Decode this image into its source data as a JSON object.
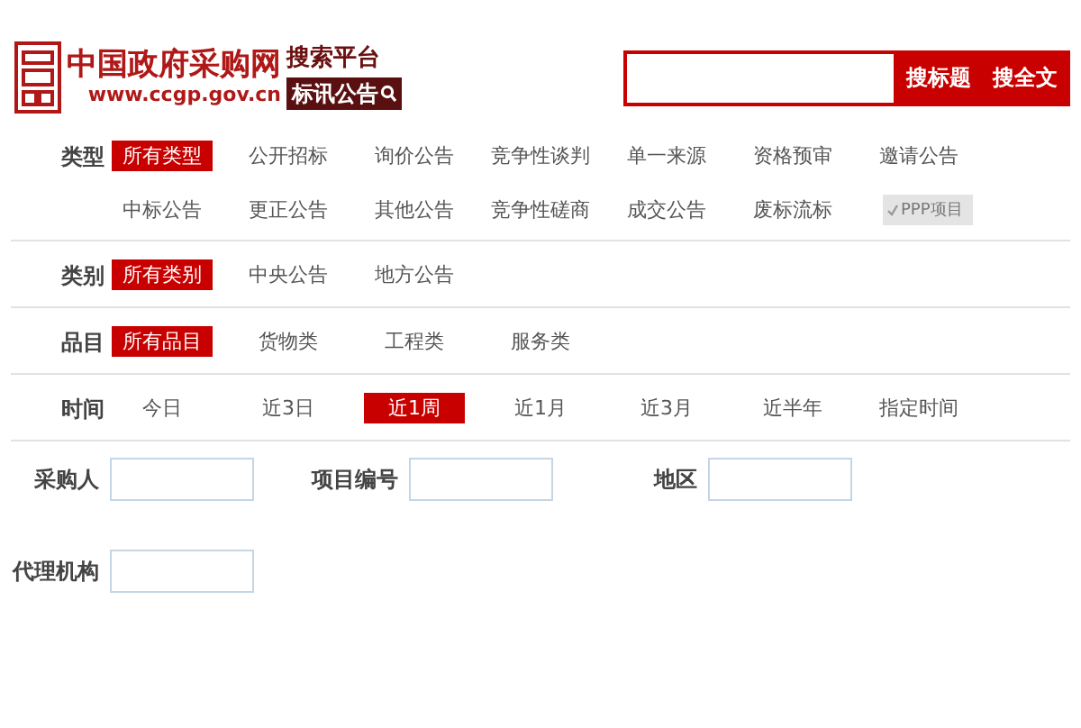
{
  "header": {
    "site_name": "中国政府采购网",
    "site_url": "www.ccgp.gov.cn",
    "platform": "搜索平台",
    "subtitle": "标讯公告"
  },
  "search": {
    "buttons": [
      "搜标题",
      "搜全文"
    ]
  },
  "filters": [
    {
      "label": "类型",
      "options": [
        {
          "label": "所有类型",
          "selected": true
        },
        {
          "label": "公开招标",
          "selected": false
        },
        {
          "label": "询价公告",
          "selected": false
        },
        {
          "label": "竞争性谈判",
          "selected": false
        },
        {
          "label": "单一来源",
          "selected": false
        },
        {
          "label": "资格预审",
          "selected": false
        },
        {
          "label": "邀请公告",
          "selected": false
        },
        {
          "label": "中标公告",
          "selected": false
        },
        {
          "label": "更正公告",
          "selected": false
        },
        {
          "label": "其他公告",
          "selected": false
        },
        {
          "label": "竞争性磋商",
          "selected": false
        },
        {
          "label": "成交公告",
          "selected": false
        },
        {
          "label": "废标流标",
          "selected": false
        },
        {
          "label": "PPP项目",
          "selected": false,
          "kind": "checkbox",
          "checked": true
        }
      ]
    },
    {
      "label": "类别",
      "options": [
        {
          "label": "所有类别",
          "selected": true
        },
        {
          "label": "中央公告",
          "selected": false
        },
        {
          "label": "地方公告",
          "selected": false
        }
      ]
    },
    {
      "label": "品目",
      "options": [
        {
          "label": "所有品目",
          "selected": true
        },
        {
          "label": "货物类",
          "selected": false
        },
        {
          "label": "工程类",
          "selected": false
        },
        {
          "label": "服务类",
          "selected": false
        }
      ]
    },
    {
      "label": "时间",
      "options": [
        {
          "label": "今日",
          "selected": false
        },
        {
          "label": "近3日",
          "selected": false
        },
        {
          "label": "近1周",
          "selected": true
        },
        {
          "label": "近1月",
          "selected": false
        },
        {
          "label": "近3月",
          "selected": false
        },
        {
          "label": "近半年",
          "selected": false
        },
        {
          "label": "指定时间",
          "selected": false
        }
      ]
    }
  ],
  "fields": [
    {
      "label": "采购人"
    },
    {
      "label": "项目编号"
    },
    {
      "label": "地区"
    },
    {
      "label": "代理机构"
    }
  ]
}
